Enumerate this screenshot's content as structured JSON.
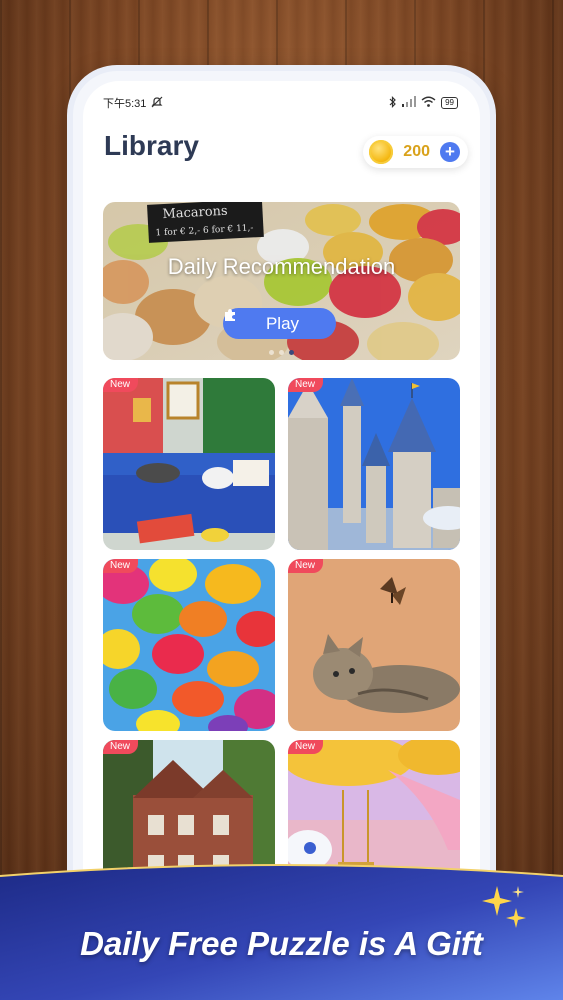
{
  "status_bar": {
    "time": "下午5:31",
    "battery": "99"
  },
  "header": {
    "title": "Library",
    "coins": "200"
  },
  "banner": {
    "title": "Daily Recommendation",
    "play_label": "Play",
    "sign_line1": "Macarons",
    "sign_line2": "1 for € 2,- 6 for € 11,-"
  },
  "puzzles": [
    {
      "badge": "New",
      "subject": "cats-on-blue-sofa"
    },
    {
      "badge": "New",
      "subject": "fairytale-castle"
    },
    {
      "badge": "New",
      "subject": "colorful-umbrellas"
    },
    {
      "badge": "New",
      "subject": "cat-and-butterfly"
    },
    {
      "badge": "New",
      "subject": "brick-mansion"
    },
    {
      "badge": "New",
      "subject": "whimsical-swing"
    }
  ],
  "footer": {
    "headline": "Daily Free Puzzle is A Gift"
  },
  "colors": {
    "accent": "#4f7af0",
    "badge": "#f04a5c",
    "title": "#2e3a55",
    "coin": "#d9a21b",
    "footer": "#3344b0"
  },
  "icons": [
    "silent-icon",
    "bluetooth-icon",
    "signal-icon",
    "wifi-icon",
    "battery-icon",
    "coin-icon",
    "plus-icon",
    "puzzle-piece-icon",
    "sparkle-icon"
  ]
}
